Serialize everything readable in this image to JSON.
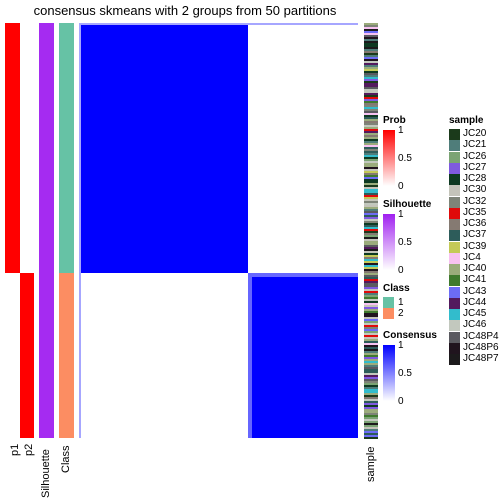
{
  "title": "consensus skmeans with 2 groups from 50 partitions",
  "column_labels": {
    "p1": "p1",
    "p2": "p2",
    "silhouette": "Silhouette",
    "class": "Class",
    "sample": "sample"
  },
  "legends": {
    "prob": {
      "title": "Prob",
      "ticks": [
        "1",
        "0.5",
        "0"
      ],
      "color": "#FF0000"
    },
    "silhouette": {
      "title": "Silhouette",
      "ticks": [
        "1",
        "0.5",
        "0"
      ],
      "color": "#A020F0"
    },
    "class": {
      "title": "Class",
      "items": [
        {
          "label": "1",
          "color": "#66C2A5"
        },
        {
          "label": "2",
          "color": "#FC8D62"
        }
      ]
    },
    "consensus": {
      "title": "Consensus",
      "ticks": [
        "1",
        "0.5",
        "0"
      ],
      "color": "#0000FF"
    },
    "sample": {
      "title": "sample",
      "items": [
        {
          "label": "JC20",
          "color": "#1B3A1B"
        },
        {
          "label": "JC21",
          "color": "#4F7D7A"
        },
        {
          "label": "JC26",
          "color": "#7BA474"
        },
        {
          "label": "JC27",
          "color": "#7F5AE0"
        },
        {
          "label": "JC28",
          "color": "#0E3A22"
        },
        {
          "label": "JC30",
          "color": "#C4C4BA"
        },
        {
          "label": "JC32",
          "color": "#7E8478"
        },
        {
          "label": "JC35",
          "color": "#E00A0A"
        },
        {
          "label": "JC36",
          "color": "#857A72"
        },
        {
          "label": "JC37",
          "color": "#2D5C5A"
        },
        {
          "label": "JC39",
          "color": "#C4CA58"
        },
        {
          "label": "JC4",
          "color": "#F8C2F2"
        },
        {
          "label": "JC40",
          "color": "#9BAC7C"
        },
        {
          "label": "JC41",
          "color": "#3F7A2E"
        },
        {
          "label": "JC43",
          "color": "#6C6CF6"
        },
        {
          "label": "JC44",
          "color": "#531A5E"
        },
        {
          "label": "JC45",
          "color": "#32BCCC"
        },
        {
          "label": "JC46",
          "color": "#C2C8BE"
        },
        {
          "label": "JC48P4",
          "color": "#5A5A60"
        },
        {
          "label": "JC48P6",
          "color": "#20141E"
        },
        {
          "label": "JC48P7",
          "color": "#1C1A1C"
        }
      ]
    }
  },
  "chart_data": {
    "type": "heatmap",
    "title": "consensus skmeans with 2 groups from 50 partitions",
    "groups": [
      {
        "class": "1",
        "fraction_of_samples": 0.6,
        "p1": 1,
        "p2": 0,
        "silhouette": 1,
        "within_consensus": 1
      },
      {
        "class": "2",
        "fraction_of_samples": 0.4,
        "p1": 0,
        "p2": 1,
        "silhouette": 1,
        "within_consensus": 1
      }
    ],
    "between_group_consensus": 0,
    "color_ranges": {
      "prob": [
        0,
        1
      ],
      "silhouette": [
        0,
        1
      ],
      "consensus": [
        0,
        1
      ]
    }
  }
}
